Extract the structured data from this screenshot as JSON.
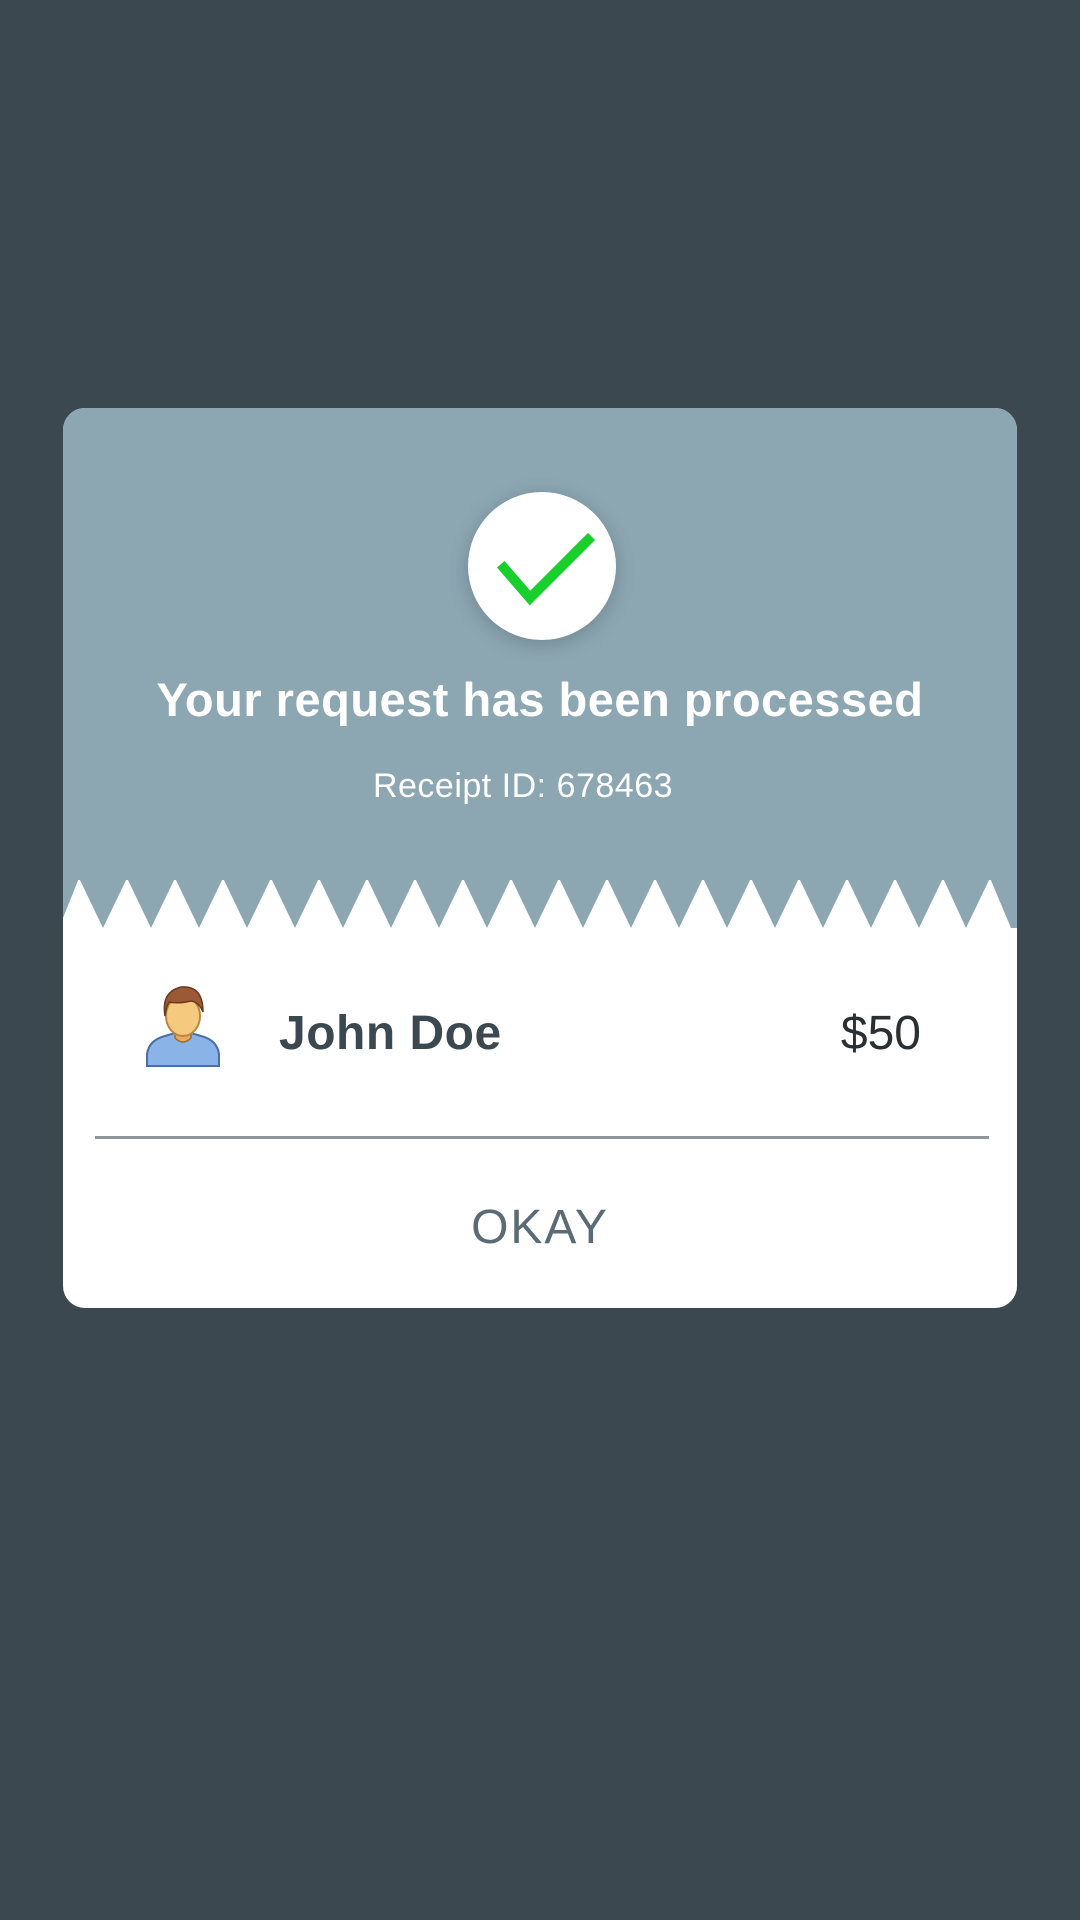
{
  "dialog": {
    "title": "Your request has been processed",
    "receipt": "Receipt ID: 678463",
    "recipient_name": "John Doe",
    "amount": "$50",
    "okay_label": "OKAY"
  },
  "colors": {
    "background": "#3c4850",
    "header": "#8ca6b2",
    "card": "#ffffff",
    "check": "#19cf2c",
    "button_text": "#5a6b75"
  },
  "icons": {
    "status": "checkmark-icon",
    "recipient": "user-avatar-icon"
  }
}
